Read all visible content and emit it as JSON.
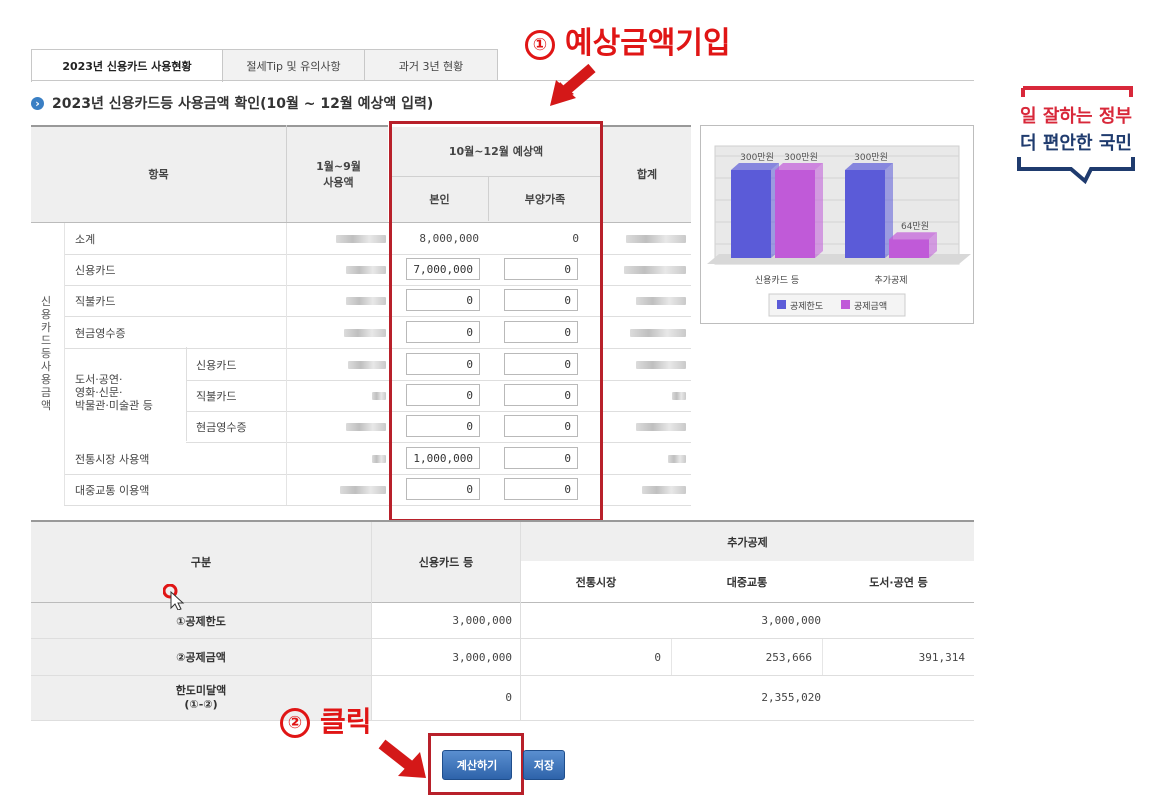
{
  "tabs": [
    {
      "label": "2023년 신용카드 사용현황"
    },
    {
      "label": "절세Tip 및 유의사항"
    },
    {
      "label": "과거 3년 현황"
    }
  ],
  "section_title": "2023년 신용카드등 사용금액 확인(10월 ~ 12월 예상액 입력)",
  "annotations": {
    "step1": {
      "num": "①",
      "text": "예상금액기입"
    },
    "step2": {
      "num": "②",
      "text": "클릭"
    }
  },
  "usage_table": {
    "headers": {
      "item": "항목",
      "jan_sep": "1월~9월\n사용액",
      "oct_dec": "10월~12월 예상액",
      "self": "본인",
      "dependents": "부양가족",
      "total": "합계"
    },
    "side_label": "신용카드등 사용금액",
    "group_label": "도서·공연·\n영화·신문·\n박물관·미술관 등",
    "rows": [
      {
        "label": "소계",
        "self": "8,000,000",
        "dependents": "0",
        "input": false
      },
      {
        "label": "신용카드",
        "self": "7,000,000",
        "dependents": "0",
        "input": true
      },
      {
        "label": "직불카드",
        "self": "0",
        "dependents": "0",
        "input": true
      },
      {
        "label": "현금영수증",
        "self": "0",
        "dependents": "0",
        "input": true
      },
      {
        "label": "신용카드",
        "self": "0",
        "dependents": "0",
        "input": true
      },
      {
        "label": "직불카드",
        "self": "0",
        "dependents": "0",
        "input": true
      },
      {
        "label": "현금영수증",
        "self": "0",
        "dependents": "0",
        "input": true
      },
      {
        "label": "전통시장 사용액",
        "self": "1,000,000",
        "dependents": "0",
        "input": true
      },
      {
        "label": "대중교통 이용액",
        "self": "0",
        "dependents": "0",
        "input": true
      }
    ]
  },
  "chart_data": {
    "type": "bar",
    "categories": [
      "신용카드 등",
      "추가공제"
    ],
    "series": [
      {
        "name": "공제한도",
        "values": [
          300,
          300
        ],
        "color": "#5b5bd8"
      },
      {
        "name": "공제금액",
        "values": [
          300,
          64
        ],
        "color": "#c05ad8"
      }
    ],
    "data_labels": [
      "300만원",
      "300만원",
      "300만원",
      "64만원"
    ],
    "ylim": [
      0,
      330
    ],
    "legend": [
      "공제한도",
      "공제금액"
    ],
    "legend_position": "bottom"
  },
  "lower_table": {
    "headers": {
      "category": "구분",
      "credit": "신용카드 등",
      "additional": "추가공제",
      "market": "전통시장",
      "transit": "대중교통",
      "culture": "도서·공연 등"
    },
    "rows": [
      {
        "label": "①공제한도",
        "credit": "3,000,000",
        "additional_merged": "3,000,000"
      },
      {
        "label": "②공제금액",
        "credit": "3,000,000",
        "market": "0",
        "transit": "253,666",
        "culture": "391,314"
      },
      {
        "label": "한도미달액\n(①-②)",
        "credit": "0",
        "additional_merged": "2,355,020"
      }
    ]
  },
  "buttons": {
    "calculate": "계산하기",
    "save": "저장"
  },
  "gov_logo": {
    "line1": "일 잘하는 정부",
    "line2": "더 편안한 국민"
  }
}
